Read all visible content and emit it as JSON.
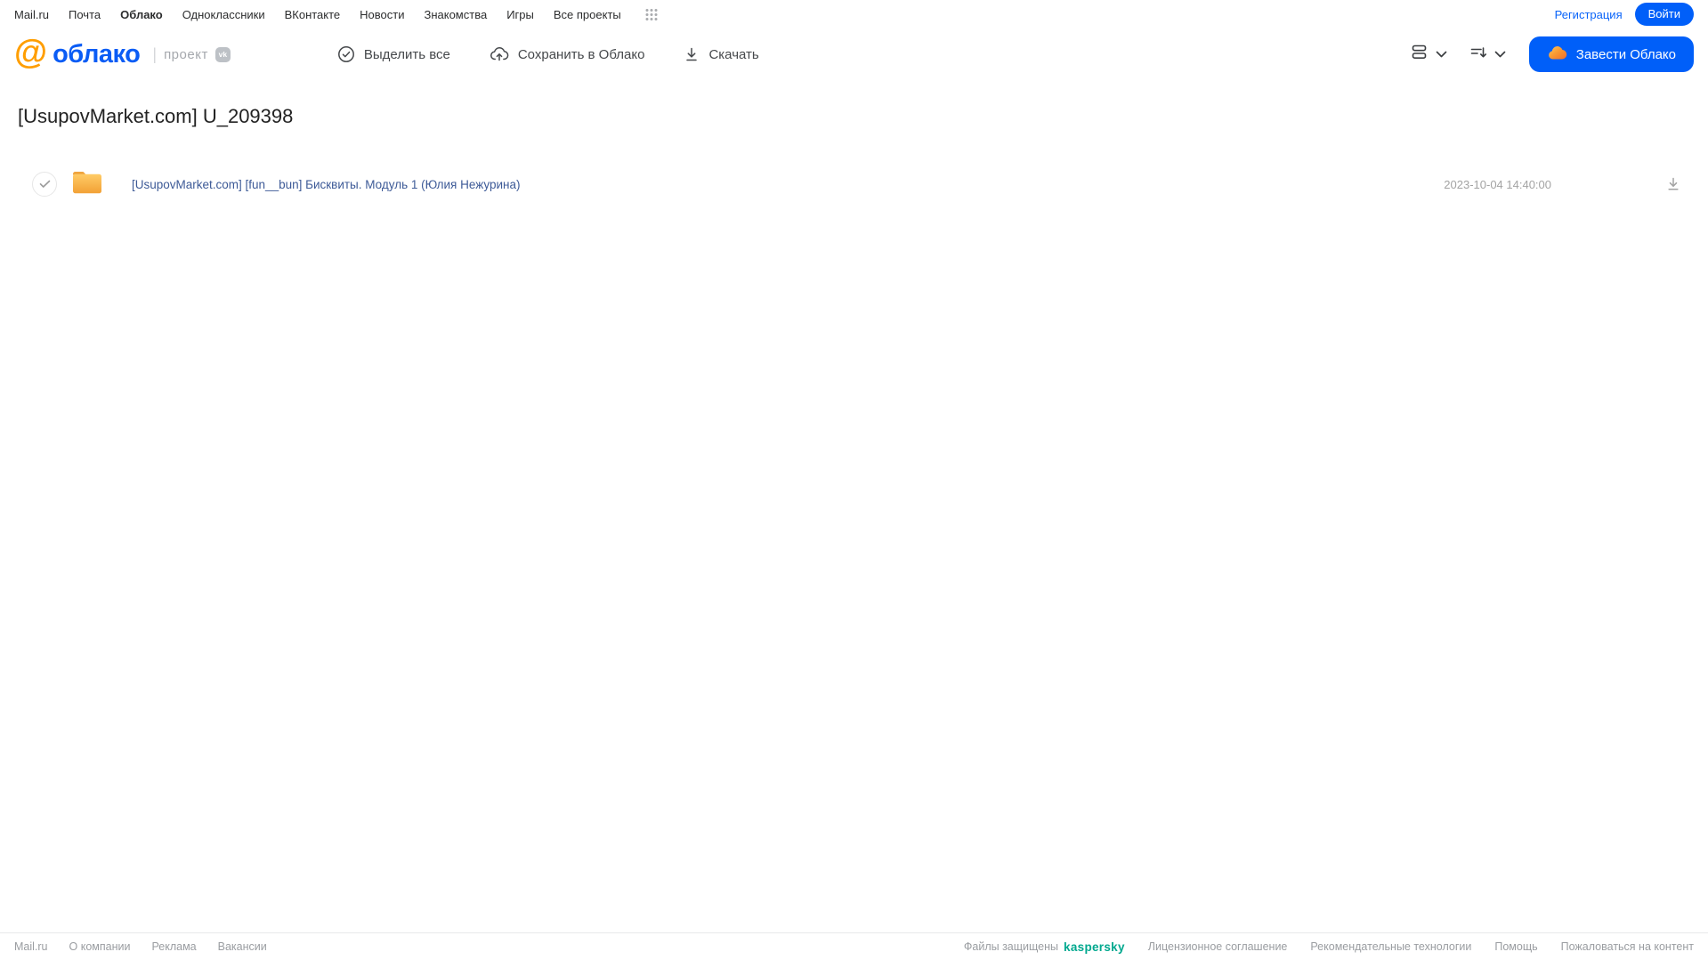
{
  "topnav": {
    "items": [
      {
        "label": "Mail.ru"
      },
      {
        "label": "Почта"
      },
      {
        "label": "Облако"
      },
      {
        "label": "Одноклассники"
      },
      {
        "label": "ВКонтакте"
      },
      {
        "label": "Новости"
      },
      {
        "label": "Знакомства"
      },
      {
        "label": "Игры"
      },
      {
        "label": "Все проекты"
      }
    ],
    "registration_label": "Регистрация",
    "login_label": "Войти"
  },
  "header": {
    "logo_at": "@",
    "logo_text": "облако",
    "project_divider": "|",
    "project_label": "проект",
    "vk_badge": "vk",
    "toolbar": {
      "select_all_label": "Выделить все",
      "save_to_cloud_label": "Сохранить в Облако",
      "download_label": "Скачать"
    },
    "get_cloud_button_label": "Завести Облако"
  },
  "main": {
    "title": "[UsupovMarket.com] U_209398",
    "files": [
      {
        "type": "folder",
        "name": "[UsupovMarket.com] [fun__bun] Бисквиты. Модуль 1 (Юлия Нежурина)",
        "modified": "2023-10-04 14:40:00"
      }
    ]
  },
  "footer": {
    "left_links": [
      "Mail.ru",
      "О компании",
      "Реклама",
      "Вакансии"
    ],
    "protected_label": "Файлы защищены",
    "kaspersky_label": "kaspersky",
    "right_links": [
      "Лицензионное соглашение",
      "Рекомендательные технологии",
      "Помощь",
      "Пожаловаться на контент"
    ]
  },
  "colors": {
    "brand_blue": "#005ff9",
    "logo_orange": "#ff9e00",
    "folder_yellow": "#f6a838",
    "kaspersky_green": "#00a88e",
    "file_link_blue": "#3d5a97"
  }
}
